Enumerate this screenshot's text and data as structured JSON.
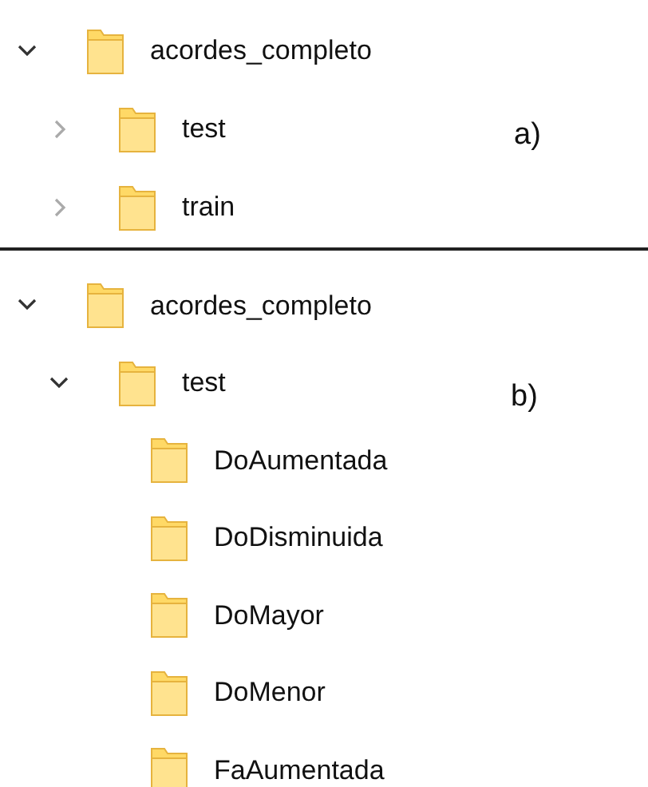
{
  "panels": [
    {
      "label": "a)",
      "tree": [
        {
          "name": "acordes_completo",
          "expanded": true,
          "children": [
            {
              "name": "test",
              "expanded": false
            },
            {
              "name": "train",
              "expanded": false
            }
          ]
        }
      ]
    },
    {
      "label": "b)",
      "tree": [
        {
          "name": "acordes_completo",
          "expanded": true,
          "children": [
            {
              "name": "test",
              "expanded": true,
              "children": [
                {
                  "name": "DoAumentada"
                },
                {
                  "name": "DoDisminuida"
                },
                {
                  "name": "DoMayor"
                },
                {
                  "name": "DoMenor"
                },
                {
                  "name": "FaAumentada"
                }
              ]
            }
          ]
        }
      ]
    }
  ]
}
